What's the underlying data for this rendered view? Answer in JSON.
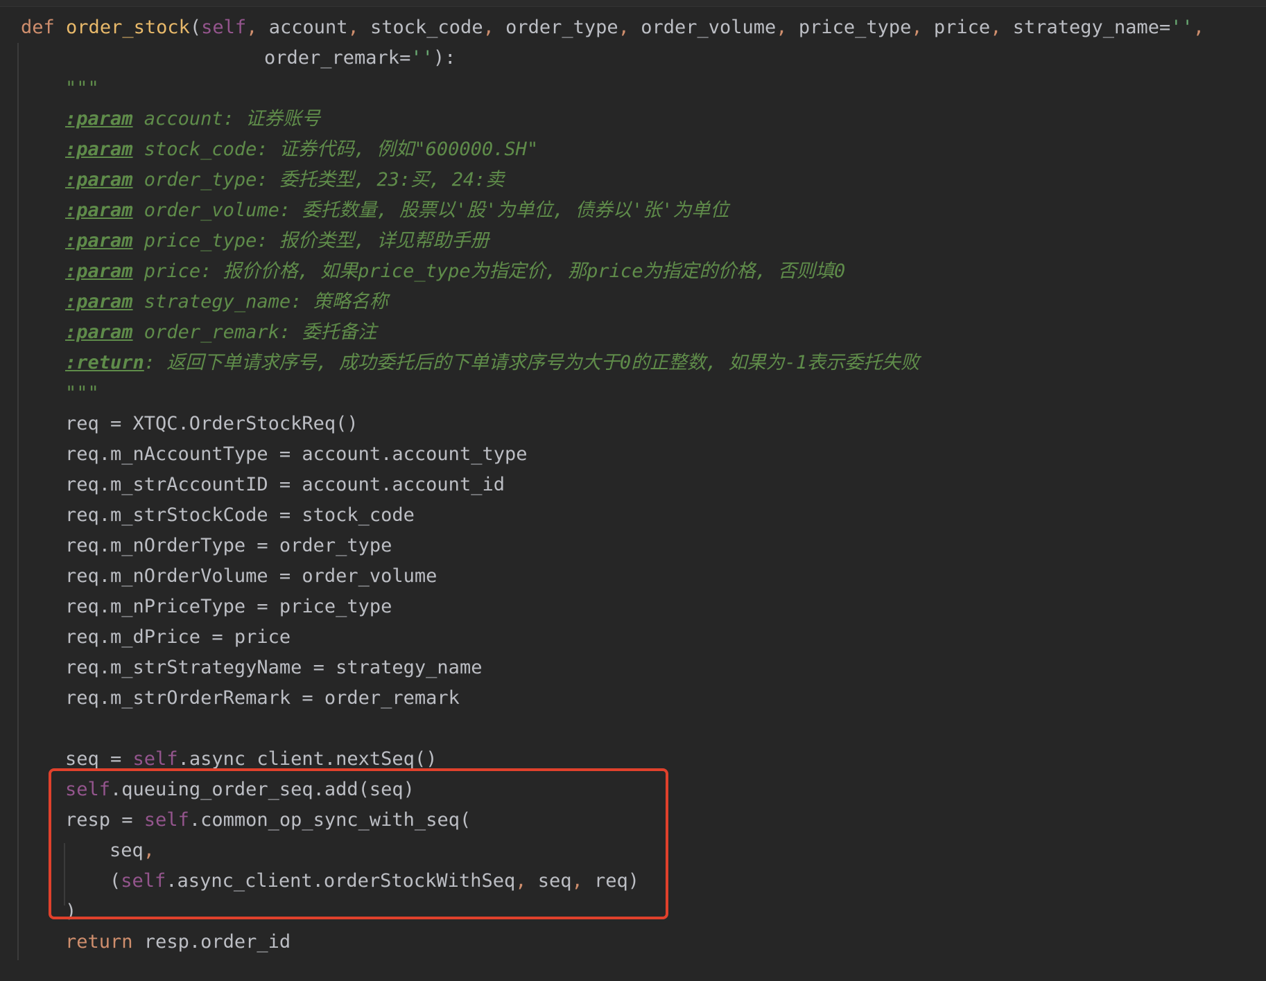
{
  "editor": {
    "signature": {
      "kw": "def",
      "name": "order_stock",
      "open": "(",
      "self": "self",
      "params_line1": [
        "account",
        "stock_code",
        "order_type",
        "order_volume",
        "price_type",
        "price"
      ],
      "strategy_param": "strategy_name=",
      "empty_str": "''",
      "comma": ",",
      "params_line2_name": "order_remark=",
      "close": "):"
    },
    "docstring": {
      "quotes": "\"\"\"",
      "params": [
        {
          "tag": ":param",
          "name": " account: ",
          "desc": "证券账号"
        },
        {
          "tag": ":param",
          "name": " stock_code: ",
          "desc": "证券代码, 例如\"600000.SH\""
        },
        {
          "tag": ":param",
          "name": " order_type: ",
          "desc": "委托类型, 23:买, 24:卖"
        },
        {
          "tag": ":param",
          "name": " order_volume: ",
          "desc": "委托数量, 股票以'股'为单位, 债券以'张'为单位"
        },
        {
          "tag": ":param",
          "name": " price_type: ",
          "desc": "报价类型, 详见帮助手册"
        },
        {
          "tag": ":param",
          "name": " price: ",
          "desc": "报价价格, 如果price_type为指定价, 那price为指定的价格, 否则填0"
        },
        {
          "tag": ":param",
          "name": " strategy_name: ",
          "desc": "策略名称"
        },
        {
          "tag": ":param",
          "name": " order_remark: ",
          "desc": "委托备注"
        }
      ],
      "return_tag": ":return",
      "return_desc": ": 返回下单请求序号, 成功委托后的下单请求序号为大于0的正整数, 如果为-1表示委托失败"
    },
    "body": [
      "req = XTQC.OrderStockReq()",
      "req.m_nAccountType = account.account_type",
      "req.m_strAccountID = account.account_id",
      "req.m_strStockCode = stock_code",
      "req.m_nOrderType = order_type",
      "req.m_nOrderVolume = order_volume",
      "req.m_nPriceType = price_type",
      "req.m_dPrice = price",
      "req.m_strStrategyName = strategy_name",
      "req.m_strOrderRemark = order_remark"
    ],
    "seq_line": {
      "pre": "seq = ",
      "self": "self",
      "post": ".async_client.nextSeq()"
    },
    "queue_line": {
      "self": "self",
      "post": ".queuing_order_seq.add(seq)"
    },
    "resp_line": {
      "pre": "resp = ",
      "self": "self",
      "post": ".common_op_sync_with_seq("
    },
    "seq_arg": {
      "text": "seq",
      "comma": ","
    },
    "tuple_line": {
      "open": "(",
      "self": "self",
      "mid": ".async_client.orderStockWithSeq",
      "c1": ",",
      "seq": " seq",
      "c2": ",",
      "req": " req)"
    },
    "close_paren": ")",
    "return_line": {
      "kw": "return",
      "post": " resp.order_id"
    }
  }
}
